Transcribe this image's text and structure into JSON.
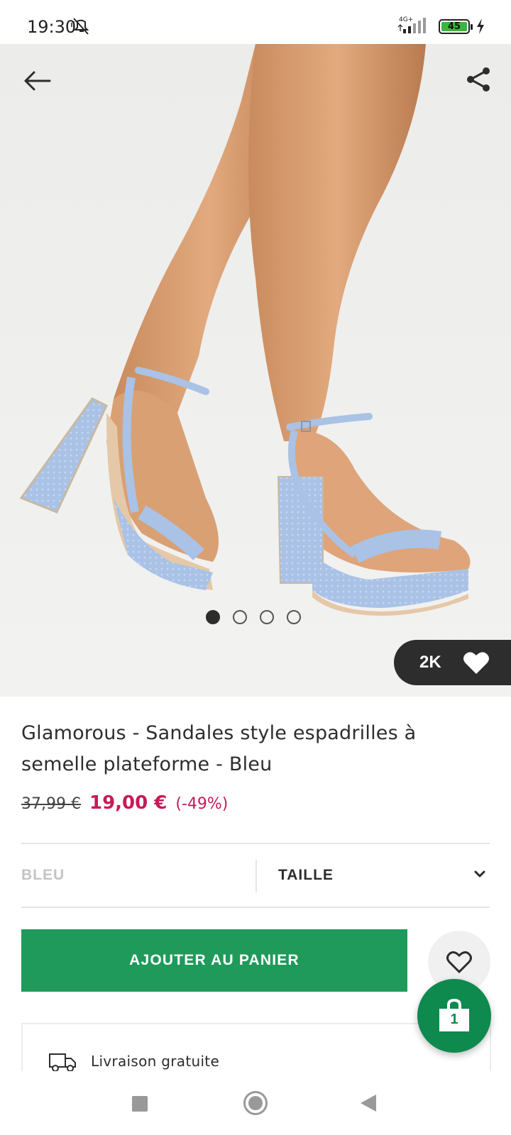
{
  "status_bar": {
    "time": "19:30",
    "network": "4G+",
    "battery": "45",
    "icons": [
      "mute-icon",
      "signal-icon",
      "battery-icon",
      "charging-icon"
    ]
  },
  "hero": {
    "icons": {
      "back": "arrow-left-icon",
      "share": "share-icon",
      "favorite": "heart-filled-icon"
    },
    "carousel": {
      "count": 4,
      "active_index": 0
    },
    "favorites_count": "2K"
  },
  "product": {
    "title": "Glamorous - Sandales style espadrilles à semelle plateforme - Bleu",
    "old_price": "37,99 €",
    "new_price": "19,00 €",
    "discount": "(-49%)"
  },
  "selectors": {
    "color": "BLEU",
    "size": "TAILLE",
    "size_icon": "chevron-down-icon"
  },
  "actions": {
    "add_to_cart": "AJOUTER AU PANIER",
    "wishlist_icon": "heart-outline-icon"
  },
  "delivery": {
    "text": "Livraison gratuite",
    "icon": "truck-icon"
  },
  "bag": {
    "count": "1",
    "icon": "shopping-bag-icon"
  },
  "nav": {
    "icons": [
      "recent-apps-icon",
      "home-icon",
      "back-icon"
    ]
  },
  "colors": {
    "accent_green": "#209a5a",
    "bag_green": "#0e8a4f",
    "sale_pink": "#c8195a",
    "dark": "#2d2d2d"
  }
}
